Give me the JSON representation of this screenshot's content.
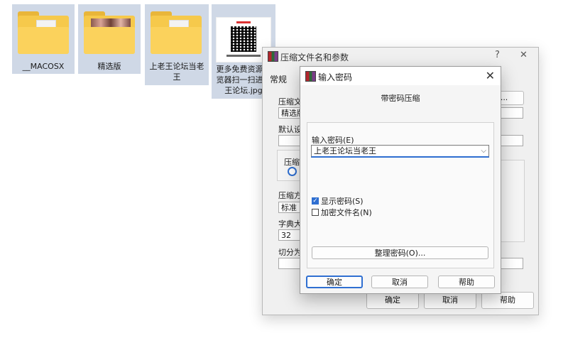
{
  "desktop": {
    "files": [
      {
        "label": "__MACOSX",
        "kind": "folder"
      },
      {
        "label": "精选版",
        "kind": "folder-photo"
      },
      {
        "label": "上老王论坛当老王",
        "kind": "folder"
      },
      {
        "label": "更多免费资源浏览器扫一扫进老王论坛.jpg",
        "kind": "qr-image"
      }
    ]
  },
  "archive_dialog": {
    "title": "压缩文件名和参数",
    "help_glyph": "?",
    "close_glyph": "✕",
    "tab_general": "常规",
    "archive_name_label": "压缩文",
    "archive_name_value": "精选版",
    "browse_label": "(B)...",
    "default_label": "默认设",
    "format_label": "压缩",
    "method_label": "压缩方",
    "method_value": "标准",
    "dict_label": "字典大",
    "dict_value": "32",
    "split_label": "切分为",
    "ok": "确定",
    "cancel": "取消",
    "help": "帮助"
  },
  "password_dialog": {
    "title": "输入密码",
    "close_glyph": "✕",
    "heading": "带密码压缩",
    "enter_label": "输入密码(E)",
    "password_value": "上老王论坛当老王",
    "show_password": {
      "label": "显示密码(S)",
      "checked": true
    },
    "encrypt_names": {
      "label": "加密文件名(N)",
      "checked": false
    },
    "organize_button": "整理密码(O)...",
    "ok": "确定",
    "cancel": "取消",
    "help": "帮助"
  },
  "colors": {
    "accent": "#2f6fd1",
    "selection": "#cfd8e6",
    "folder": "#f6c94b"
  }
}
